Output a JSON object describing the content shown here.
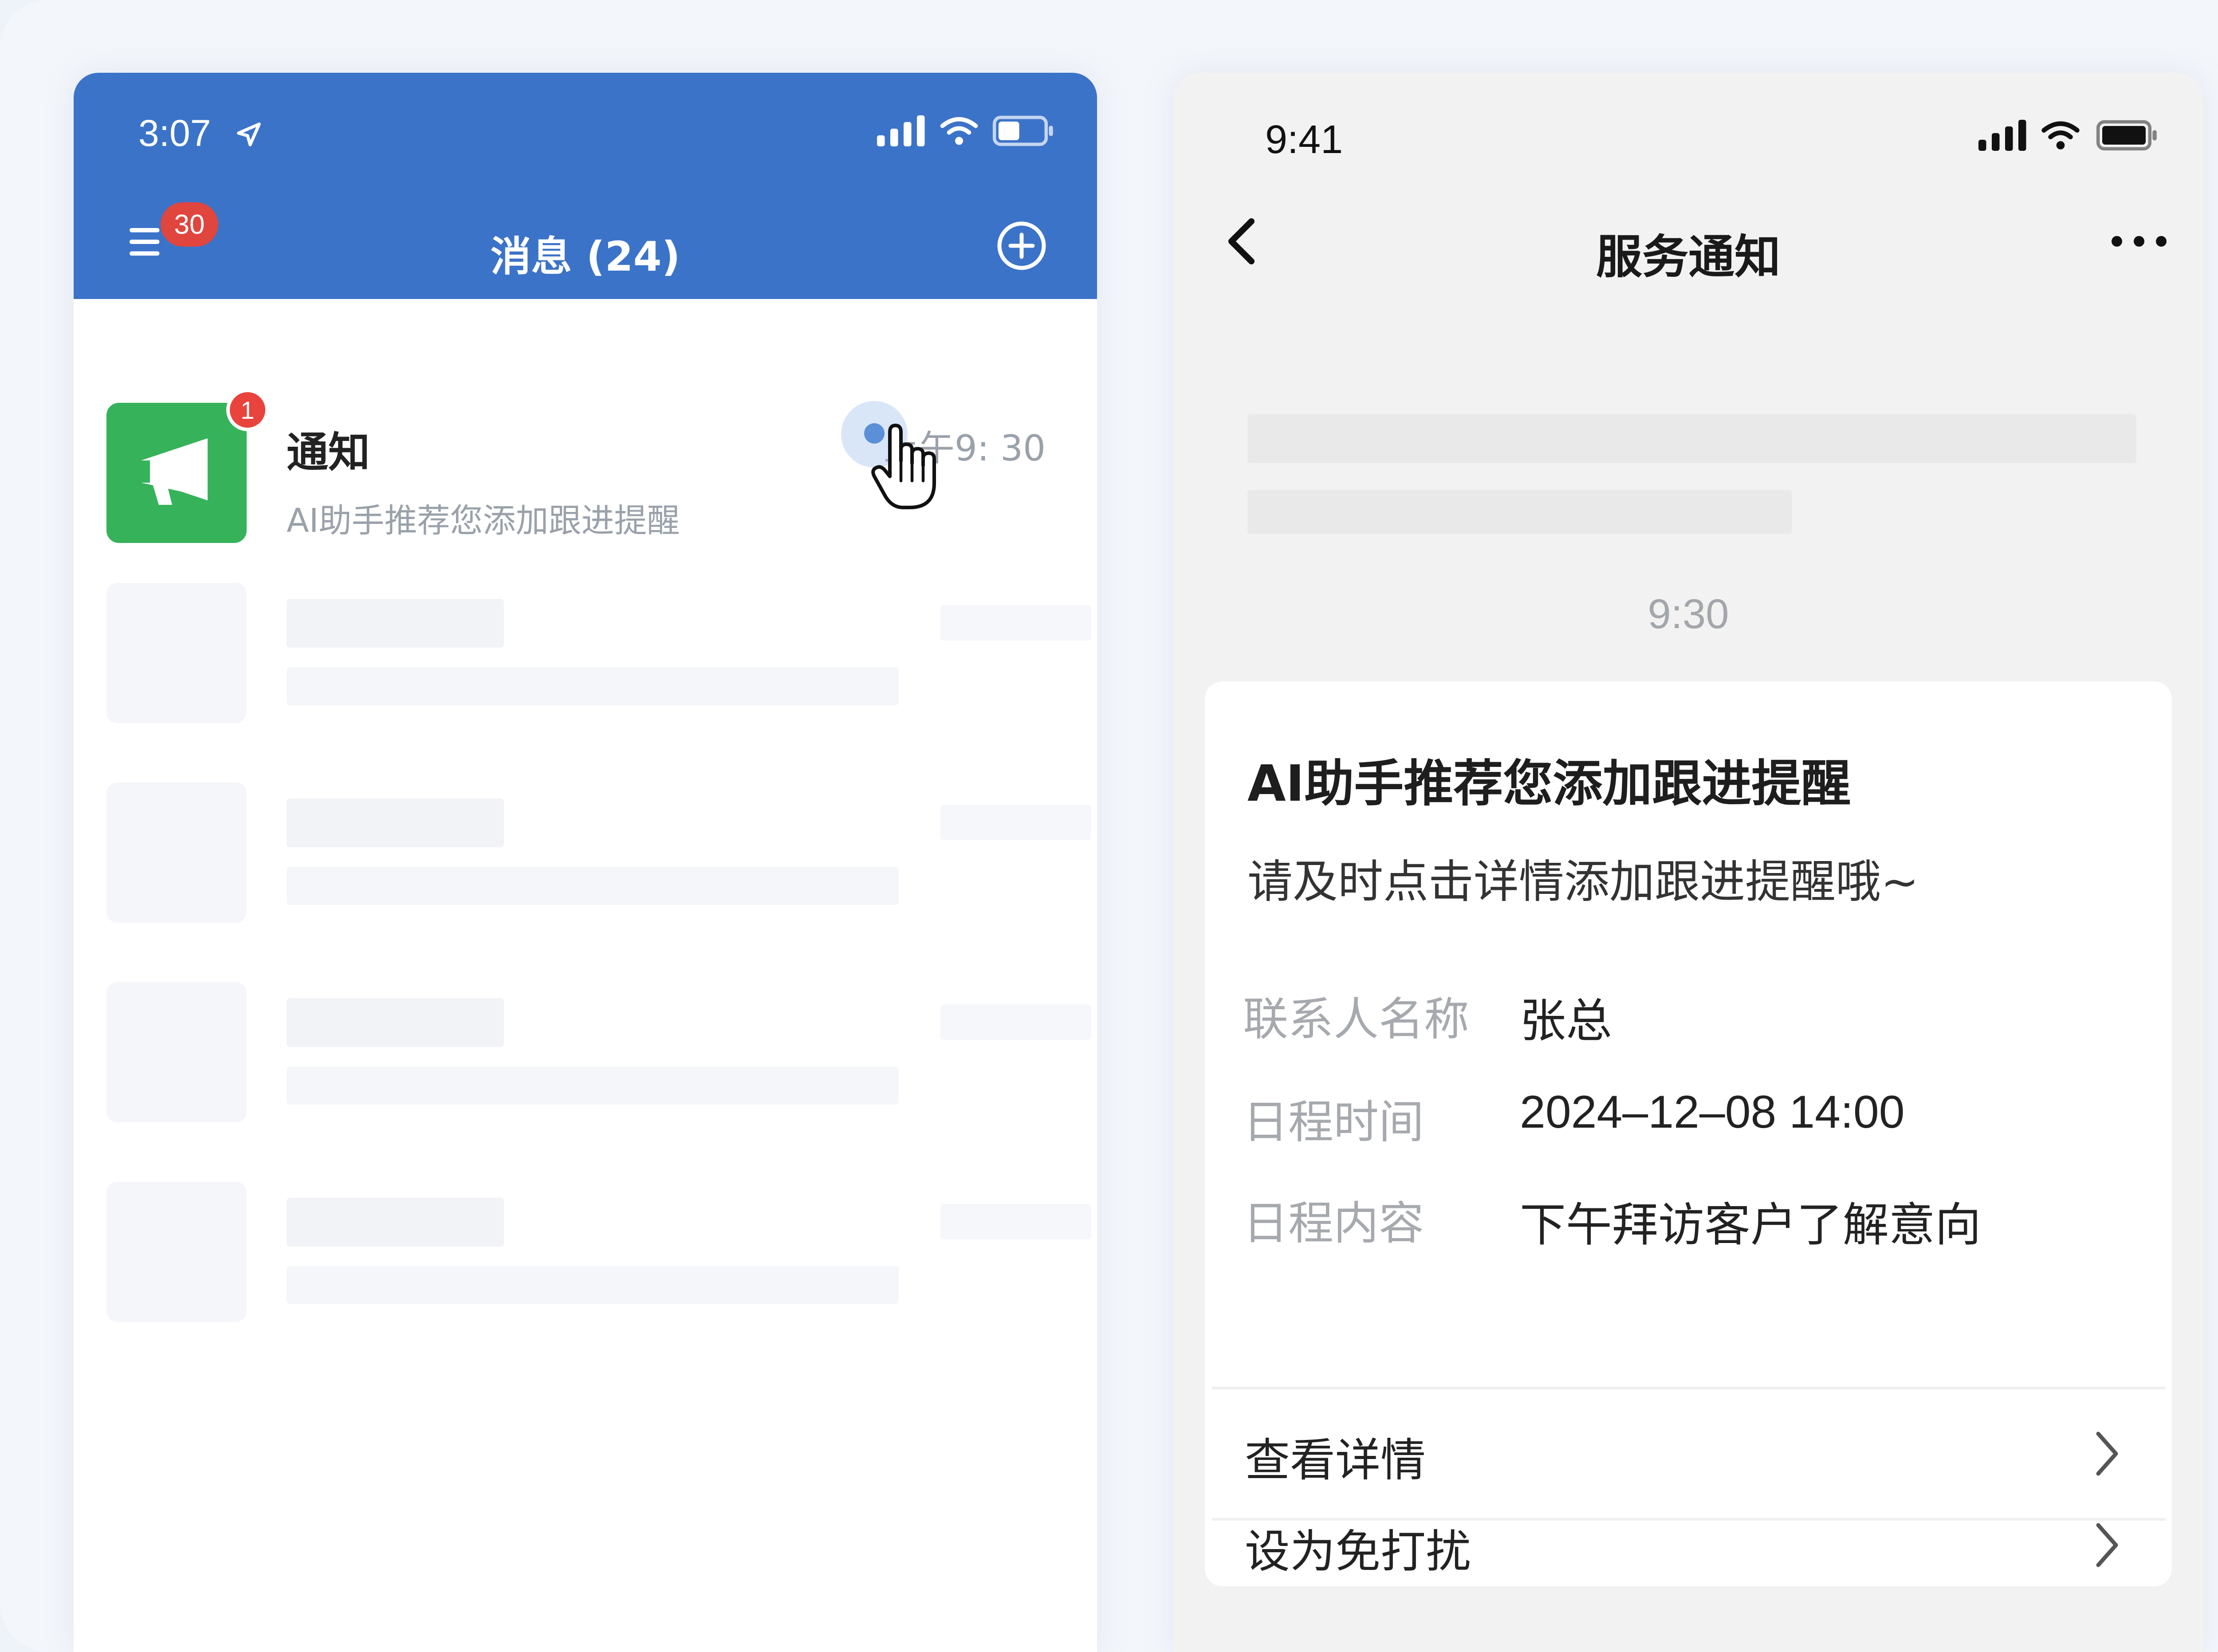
{
  "left_phone": {
    "status_time": "3:07",
    "nav": {
      "menu_badge": "30",
      "title": "消息 (24)"
    },
    "message": {
      "title": "通知",
      "badge": "1",
      "time": "上午9: 30",
      "preview": "AI助手推荐您添加跟进提醒"
    },
    "accent": "#3b73c8",
    "avatar_color": "#36b25a"
  },
  "right_phone": {
    "status_time": "9:41",
    "nav": {
      "title": "服务通知"
    },
    "timestamp": "9:30",
    "card": {
      "title": "AI助手推荐您添加跟进提醒",
      "description": "请及时点击详情添加跟进提醒哦~",
      "fields": [
        {
          "label": "联系人名称",
          "value": "张总"
        },
        {
          "label": "日程时间",
          "value": "2024–12–08 14:00"
        },
        {
          "label": "日程内容",
          "value": "下午拜访客户了解意向"
        }
      ],
      "actions": [
        {
          "label": "查看详情"
        },
        {
          "label": "设为免打扰"
        }
      ]
    }
  }
}
